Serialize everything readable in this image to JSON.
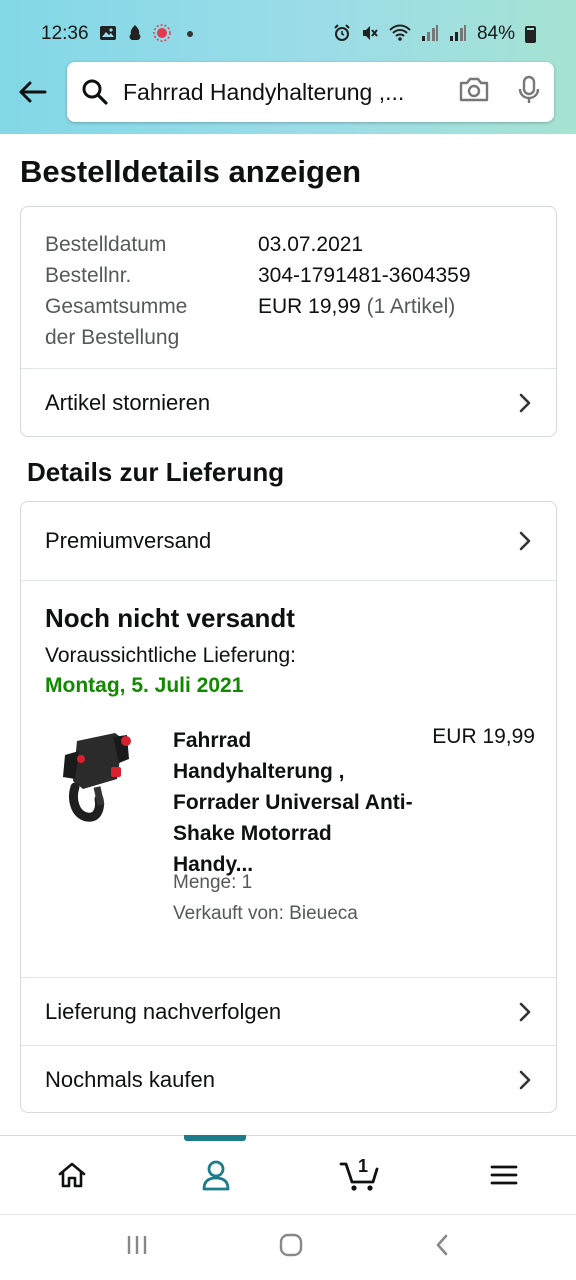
{
  "status_bar": {
    "time": "12:36",
    "battery": "84%",
    "icons": [
      "gallery-icon",
      "app-icon",
      "recording-icon",
      "alarm-icon",
      "mute-icon",
      "wifi-icon",
      "signal-icon",
      "signal-icon",
      "battery-icon"
    ]
  },
  "search": {
    "query": "Fahrrad Handyhalterung ,...",
    "icons": [
      "back-arrow-icon",
      "search-icon",
      "camera-icon",
      "microphone-icon"
    ]
  },
  "page": {
    "title": "Bestelldetails anzeigen"
  },
  "summary": {
    "date_label": "Bestelldatum",
    "date_value": "03.07.2021",
    "number_label": "Bestellnr.",
    "number_value": "304-1791481-3604359",
    "total_label_1": "Gesamtsumme",
    "total_label_2": "der Bestellung",
    "total_value": "EUR 19,99",
    "total_count": "(1 Artikel)",
    "cancel_label": "Artikel stornieren"
  },
  "delivery": {
    "section_title": "Details zur Lieferung",
    "shipping_method": "Premiumversand",
    "status": "Noch nicht versandt",
    "expected_label": "Voraussichtliche Lieferung:",
    "expected_date": "Montag, 5. Juli 2021",
    "item": {
      "title": "Fahrrad Handyhalterung , Forrader Universal Anti-Shake Motorrad Handy...",
      "price": "EUR 19,99",
      "quantity": "Menge: 1",
      "seller": "Verkauft von: Bieueca"
    },
    "track_label": "Lieferung nachverfolgen",
    "buy_again_label": "Nochmals kaufen"
  },
  "bottom_nav": {
    "items": [
      "home-icon",
      "account-icon",
      "cart-icon",
      "menu-icon"
    ],
    "cart_count": "1",
    "active": "account-icon"
  },
  "colors": {
    "header_gradient_start": "#83d8e6",
    "header_gradient_end": "#a6e3d3",
    "delivery_date_green": "#118a00",
    "nav_accent": "#1c7c8c"
  }
}
